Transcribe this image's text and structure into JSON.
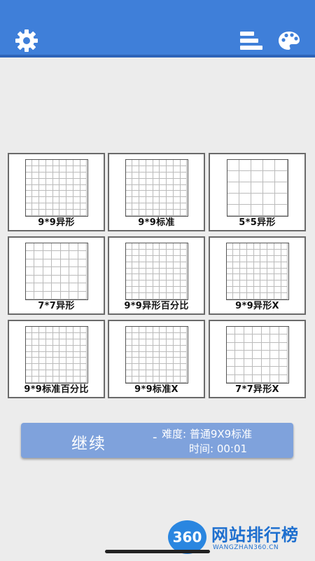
{
  "header": {
    "background": "#3f7fd9",
    "left_icon": "gear-icon",
    "right_icons": [
      "sort-icon",
      "palette-icon"
    ]
  },
  "modes": [
    {
      "label": "9*9异形"
    },
    {
      "label": "9*9标准"
    },
    {
      "label": "5*5异形"
    },
    {
      "label": "7*7异形"
    },
    {
      "label": "9*9异形百分比"
    },
    {
      "label": "9*9异形X"
    },
    {
      "label": "9*9标准百分比"
    },
    {
      "label": "9*9标准X"
    },
    {
      "label": "7*7异形X"
    }
  ],
  "continue": {
    "label": "继续",
    "dash": "-",
    "difficulty": "难度: 普通9X9标准",
    "time": "时间: 00:01",
    "color": "#7fa2dc"
  },
  "watermark": {
    "logo": "360",
    "title": "网站排行榜",
    "url": "WANGZHAN360.CN"
  }
}
